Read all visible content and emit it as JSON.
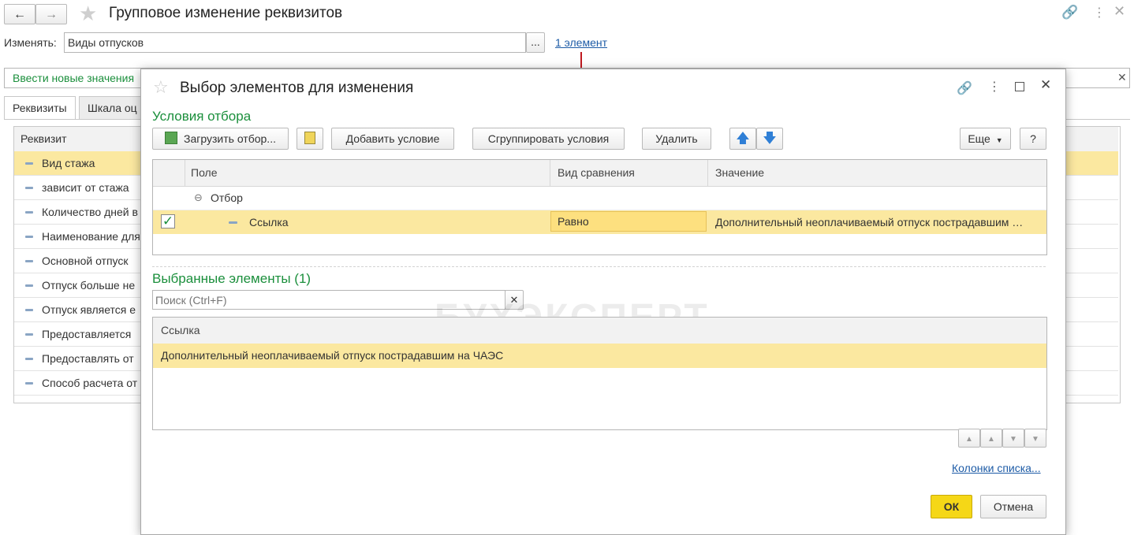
{
  "window": {
    "title": "Групповое изменение реквизитов",
    "change_label": "Изменять:",
    "change_value": "Виды отпусков",
    "select_btn": "...",
    "elements_link": "1 элемент",
    "enter_values_label": "Ввести новые значения",
    "tabs": [
      {
        "label": "Реквизиты"
      },
      {
        "label": "Шкала оц"
      }
    ],
    "table_header": "Реквизит",
    "rows": [
      {
        "label": "Вид стажа"
      },
      {
        "label": "зависит от стажа"
      },
      {
        "label": "Количество дней в"
      },
      {
        "label": "Наименование для"
      },
      {
        "label": "Основной отпуск"
      },
      {
        "label": "Отпуск больше не"
      },
      {
        "label": "Отпуск является е"
      },
      {
        "label": "Предоставляется"
      },
      {
        "label": "Предоставлять от"
      },
      {
        "label": "Способ расчета от"
      }
    ]
  },
  "dialog": {
    "title": "Выбор элементов для изменения",
    "filter_section_title": "Условия отбора",
    "toolbar": {
      "load_filter": "Загрузить отбор...",
      "add_condition": "Добавить условие",
      "group_conditions": "Сгруппировать условия",
      "delete": "Удалить",
      "more": "Еще",
      "help": "?"
    },
    "filter_columns": {
      "field": "Поле",
      "comparison": "Вид сравнения",
      "value": "Значение"
    },
    "filter_group": "Отбор",
    "filter_row": {
      "field": "Ссылка",
      "comparison": "Равно",
      "value": "Дополнительный неоплачиваемый отпуск пострадавшим …"
    },
    "selected_title": "Выбранные элементы (1)",
    "search_placeholder": "Поиск (Ctrl+F)",
    "selected_column": "Ссылка",
    "selected_items": [
      {
        "label": "Дополнительный неоплачиваемый отпуск пострадавшим на ЧАЭС"
      }
    ],
    "columns_link": "Колонки списка...",
    "ok": "ОК",
    "cancel": "Отмена"
  },
  "watermark": "БУХЭКСПЕРТ",
  "colors": {
    "accent_green": "#1b8f3c",
    "highlight_row": "#fbe8a0",
    "ok_button": "#f5d717",
    "link_blue": "#1d5ba6",
    "arrow_red": "#c0181f"
  }
}
